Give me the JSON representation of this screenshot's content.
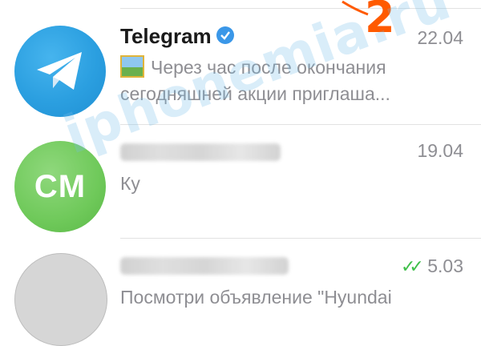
{
  "chats": [
    {
      "name": "Telegram",
      "verified": true,
      "date": "22.04",
      "preview_line1": "Через час после окончания",
      "preview_line2": "сегодняшней акции приглаша...",
      "avatar_icon": "paper-plane-icon",
      "avatar_color": "#2b9fe0"
    },
    {
      "name": "",
      "date": "19.04",
      "preview": "Ку",
      "avatar_initials": "CM",
      "avatar_color": "#6fc95a"
    },
    {
      "name": "",
      "date": "5.03",
      "preview": "Посмотри объявление \"Hyundai",
      "read_status_icon": "double-check-icon",
      "avatar_color": "#d6d6d6"
    }
  ],
  "annotation_number": "2",
  "watermark": "iphonemia.ru",
  "colors": {
    "annotation": "#ff5a00",
    "read_check": "#3fbf4a",
    "verified": "#3a97e8"
  }
}
